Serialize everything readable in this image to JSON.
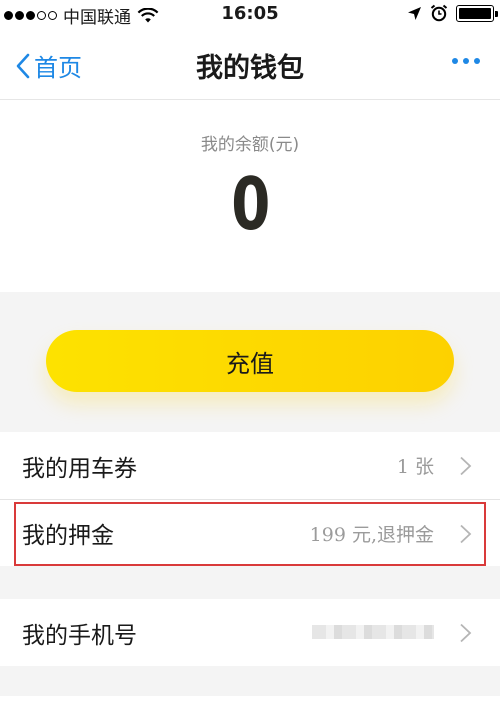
{
  "status_bar": {
    "carrier": "中国联通",
    "time": "16:05",
    "signal_bars_filled": 3,
    "signal_bars_total": 5
  },
  "nav": {
    "back_label": "首页",
    "title": "我的钱包"
  },
  "balance": {
    "label": "我的余额(元)",
    "amount": "0"
  },
  "recharge": {
    "label": "充值"
  },
  "menu": {
    "items": [
      {
        "label": "我的用车券",
        "value": "1 张"
      },
      {
        "label": "我的押金",
        "value": "199 元,退押金"
      }
    ],
    "phone": {
      "label": "我的手机号"
    }
  },
  "colors": {
    "accent_blue": "#1e88e5",
    "recharge_yellow": "#fdd800",
    "highlight_red": "#d93a3a"
  }
}
